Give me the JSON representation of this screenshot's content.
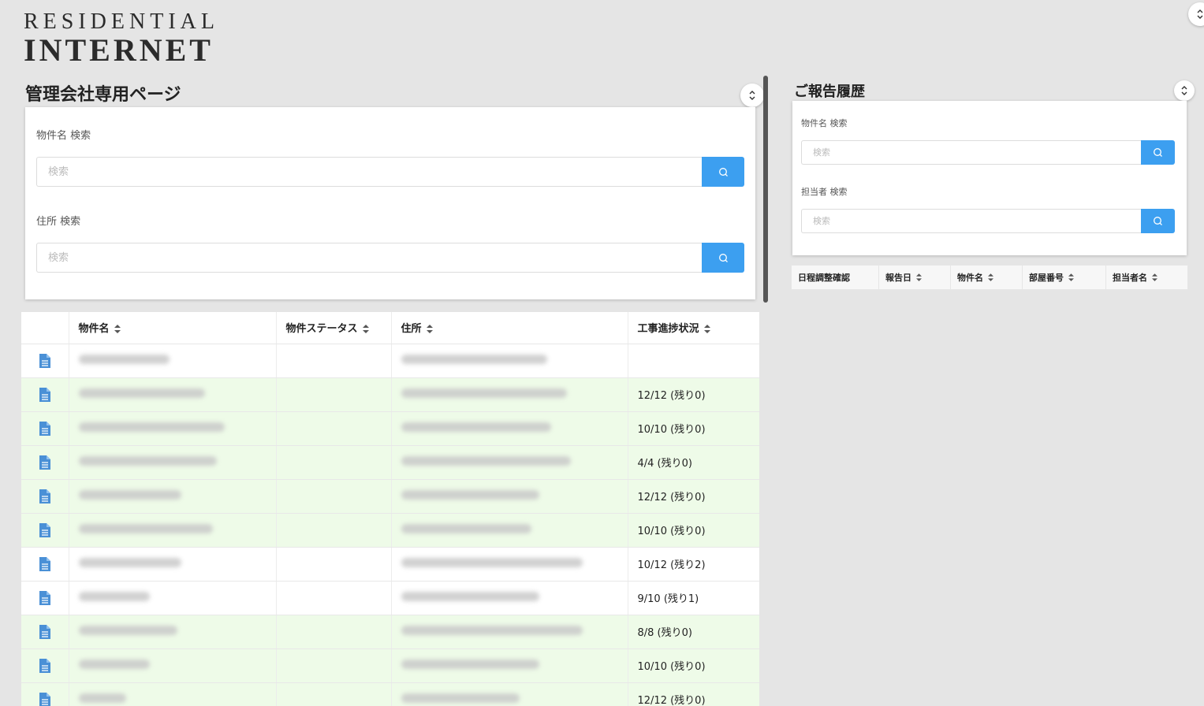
{
  "logo": {
    "line1": "RESIDENTIAL",
    "line2": "INTERNET"
  },
  "management": {
    "title": "管理会社専用ページ",
    "property_search": {
      "label": "物件名 検索",
      "placeholder": "検索"
    },
    "address_search": {
      "label": "住所 検索",
      "placeholder": "検索"
    },
    "table": {
      "columns": [
        "物件名",
        "物件ステータス",
        "住所",
        "工事進捗状況"
      ],
      "rows": [
        {
          "progress": "",
          "highlight": false
        },
        {
          "progress": "12/12 (残り0)",
          "highlight": true
        },
        {
          "progress": "10/10 (残り0)",
          "highlight": true
        },
        {
          "progress": "4/4 (残り0)",
          "highlight": true
        },
        {
          "progress": "12/12 (残り0)",
          "highlight": true
        },
        {
          "progress": "10/10 (残り0)",
          "highlight": true
        },
        {
          "progress": "10/12 (残り2)",
          "highlight": false
        },
        {
          "progress": "9/10 (残り1)",
          "highlight": false
        },
        {
          "progress": "8/8 (残り0)",
          "highlight": true
        },
        {
          "progress": "10/10 (残り0)",
          "highlight": true
        },
        {
          "progress": "12/12 (残り0)",
          "highlight": true
        }
      ]
    }
  },
  "reports": {
    "title": "ご報告履歴",
    "property_search": {
      "label": "物件名 検索",
      "placeholder": "検索"
    },
    "staff_search": {
      "label": "担当者 検索",
      "placeholder": "検索"
    },
    "columns": [
      "日程調整確認",
      "報告日",
      "物件名",
      "部屋番号",
      "担当者名"
    ]
  },
  "colors": {
    "accent": "#3c9ff0",
    "doc_icon": "#4a90d6",
    "row_highlight": "#eefbe8"
  }
}
